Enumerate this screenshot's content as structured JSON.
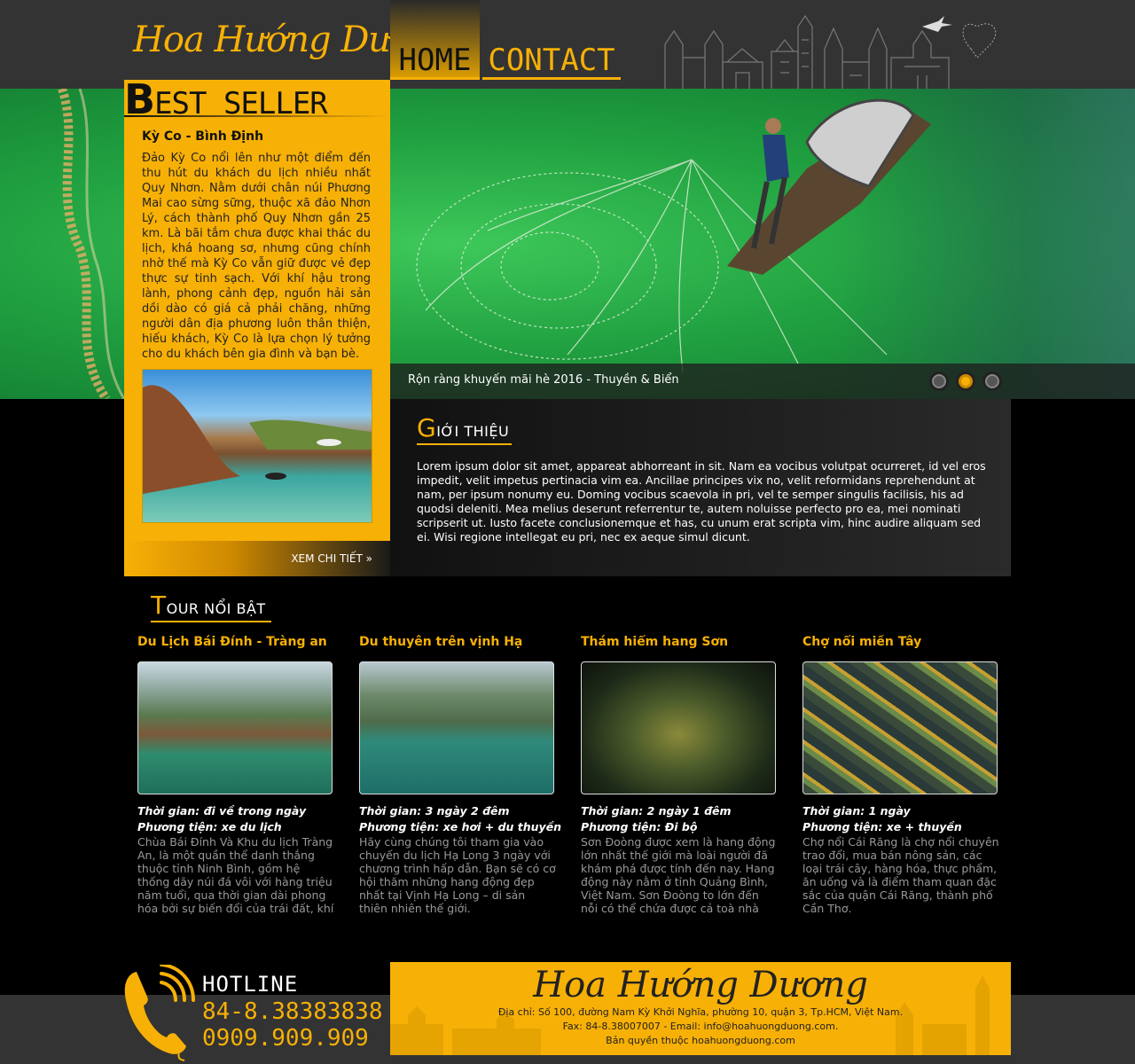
{
  "header": {
    "logo": "Hoa Hướng Dương",
    "nav": {
      "home": "HOME",
      "contact": "CONTACT"
    }
  },
  "colors": {
    "accent": "#f7b006",
    "header_bg": "#333333",
    "page_bg": "#000000"
  },
  "hero": {
    "caption": "Rộn ràng khuyến mãi hè 2016 - Thuyền & Biển",
    "slide_count": 3,
    "active_slide": 2
  },
  "bestseller": {
    "title_first": "B",
    "title_rest": "EST SELLER",
    "heading": "Kỳ Co - Bình Định",
    "text": "Đảo Kỳ Co nổi lên như một điểm đến thu hút du khách du lịch nhiều nhất Quy Nhơn. Nằm dưới chân núi Phương Mai cao sừng sững, thuộc xã đảo Nhơn Lý, cách thành phố Quy Nhơn gần 25 km. Là bãi tắm chưa được khai thác du lịch, khá hoang sơ, nhưng cũng chính nhờ thế mà Kỳ Co vẫn giữ được vẻ đẹp thực sự tinh sạch. Với khí hậu trong lành, phong cảnh đẹp, nguồn hải sản dồi dào có giá cả phải chăng, những người dân địa phương luôn thân thiện, hiếu khách, Kỳ Co là lựa chọn lý tưởng cho du khách bên gia đình và bạn bè.",
    "more": "XEM CHI TIẾT »"
  },
  "intro": {
    "title_first": "G",
    "title_rest": "IỚI THIỆU",
    "text": "Lorem ipsum dolor sit amet, appareat abhorreant in sit. Nam ea vocibus volutpat ocurreret, id vel eros impedit, velit impetus pertinacia vim ea. Ancillae principes vix no, velit reformidans reprehendunt at nam, per ipsum nonumy eu. Doming vocibus scaevola in pri, vel te semper singulis facilisis, his ad quodsi deleniti. Mea melius deserunt referrentur te, autem noluisse perfecto pro ea, mei nominati scripserit ut. Iusto facete conclusionemque et has, cu unum erat scripta vim, hinc audire aliquam sed ei. Wisi regione intellegat eu pri, nec ex aeque simul dicunt."
  },
  "tours": {
    "title_first": "T",
    "title_rest": "OUR NỔI BẬT",
    "items": [
      {
        "name": "Du Lịch Bái Đính - Tràng an",
        "time": "Thời gian: đi về trong ngày",
        "vehicle": "Phương tiện: xe du lịch",
        "desc": "Chùa Bái Đính Và Khu du lịch Tràng An, là một quần thể danh thắng thuộc tỉnh Ninh Bình, gồm hệ thống dãy núi đá vôi với hàng triệu năm tuổi, qua thời gian dài phong hóa bởi sự biến đổi của trái đất, khí hậu,"
      },
      {
        "name": "Du thuyên trên vịnh Hạ",
        "time": "Thời gian: 3 ngày 2 đêm",
        "vehicle": "Phương tiện: xe hơi + du thuyền",
        "desc": "Hãy cùng chúng tôi tham gia vào chuyến du lịch Hạ Long 3 ngày với chương trình hấp dẫn. Bạn sẽ có cơ hội thăm những hang động đẹp nhất tại Vịnh Hạ Long – di sản thiên nhiên thế giới."
      },
      {
        "name": "Thám hiểm hang Sơn",
        "time": "Thời gian: 2 ngày 1 đêm",
        "vehicle": "Phương tiện: Đi bộ",
        "desc": "Sơn Đoòng được xem là hang động lớn nhất thế giới mà loài người đã khám phá được tính đến nay. Hang động này nằm ở tỉnh Quảng Bình, Việt Nam. Sơn Đoòng to lớn đến nỗi có thể chứa được cả toà nhà cao"
      },
      {
        "name": "Chợ nổi miền Tây",
        "time": "Thời gian: 1 ngày",
        "vehicle": "Phương tiện: xe + thuyền",
        "desc": "Chợ nổi Cái Răng là chợ nổi chuyên trao đổi, mua bán nông sản, các loại trái cây, hàng hóa, thực phẩm, ăn uống và là điểm tham quan đặc sắc của quận Cái Răng, thành phố Cần Thơ."
      }
    ]
  },
  "footer": {
    "hotline_label": "HOTLINE",
    "phone1": "84-8.38383838",
    "phone2": "0909.909.909",
    "logo": "Hoa Hướng Dương",
    "address": "Địa chỉ: Số 100, đường Nam Kỳ Khởi Nghĩa, phường 10, quận 3, Tp.HCM, Việt Nam.",
    "contact": "Fax: 84-8.38007007 - Email: info@hoahuongduong.com.",
    "copyright": "Bản quyền thuộc hoahuongduong.com"
  }
}
